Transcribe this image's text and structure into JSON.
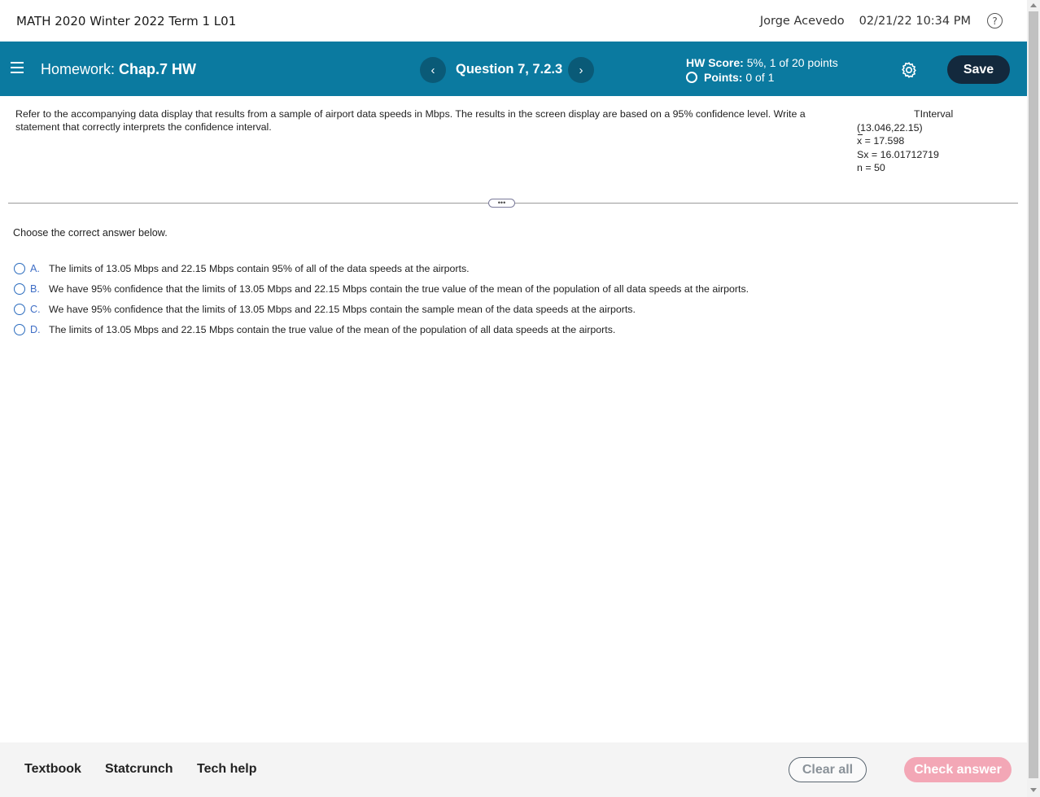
{
  "header": {
    "course_title": "MATH 2020 Winter 2022 Term 1 L01",
    "user_name": "Jorge Acevedo",
    "datetime": "02/21/22 10:34 PM",
    "help_glyph": "?"
  },
  "navbar": {
    "hw_prefix": "Homework:",
    "hw_name": "Chap.7 HW",
    "prev_glyph": "‹",
    "next_glyph": "›",
    "question_label": "Question 7, 7.2.3",
    "hw_score_label": "HW Score:",
    "hw_score_value": "5%, 1 of 20 points",
    "points_label": "Points:",
    "points_value": "0 of 1",
    "save_label": "Save",
    "accent_color": "#0b7aa0"
  },
  "question": {
    "prompt": "Refer to the accompanying data display that results from a sample of airport data speeds in Mbps. The results in the screen display are based on a 95% confidence level. Write a statement that correctly interprets the confidence interval.",
    "display": {
      "heading": "TInterval",
      "interval": "(13.046,22.15)",
      "mean_symbol": "x",
      "mean_value": "= 17.598",
      "sx": "Sx = 16.01712719",
      "n": "n = 50"
    },
    "expander_glyph": "•••",
    "choose_text": "Choose the correct answer below.",
    "answers": [
      {
        "letter": "A.",
        "text": "The limits of 13.05 Mbps and 22.15 Mbps contain 95% of all of the data speeds at the airports."
      },
      {
        "letter": "B.",
        "text": "We have 95% confidence that the limits of 13.05 Mbps and 22.15 Mbps contain the true value of the mean of the population of all data speeds at the airports."
      },
      {
        "letter": "C.",
        "text": "We have 95% confidence that the limits of 13.05 Mbps and 22.15 Mbps contain the sample mean of the data speeds at the airports."
      },
      {
        "letter": "D.",
        "text": "The limits of 13.05 Mbps and 22.15 Mbps contain the true value of the mean of the population of all data speeds at the airports."
      }
    ]
  },
  "footer": {
    "links": [
      "Textbook",
      "Statcrunch",
      "Tech help"
    ],
    "clear_label": "Clear all",
    "check_label": "Check answer"
  }
}
